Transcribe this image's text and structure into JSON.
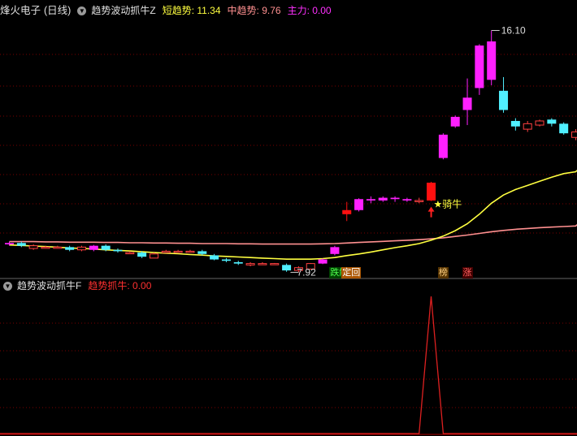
{
  "header": {
    "stock_name": "烽火电子",
    "period": "(日线)",
    "indicator": "趋势波动抓牛Z",
    "short_trend": {
      "label": "短趋势:",
      "value": "11.34",
      "color": "#ffff40"
    },
    "mid_trend": {
      "label": "中趋势:",
      "value": "9.76",
      "color": "#ff9090"
    },
    "main_force": {
      "label": "主力:",
      "value": "0.00",
      "color": "#ff30ff"
    }
  },
  "sub_header": {
    "indicator": "趋势波动抓牛F",
    "signal": {
      "label": "趋势抓牛:",
      "value": "0.00",
      "color": "#ff3030"
    }
  },
  "annotations": {
    "high_price": "16.10",
    "low_price": "7.92",
    "signal_label": "★骑牛"
  },
  "tags": [
    {
      "text": "跌解",
      "color": "#50ff50",
      "bg": "#004400",
      "index": 27
    },
    {
      "text": "定回",
      "color": "#ffffff",
      "bg": "#aa5500",
      "index": 28
    },
    {
      "text": "榜",
      "color": "#ffd080",
      "bg": "#553300",
      "index": 36
    },
    {
      "text": "涨",
      "color": "#ff6060",
      "bg": "#440000",
      "index": 38
    }
  ],
  "colors": {
    "up_hollow": "#ff4040",
    "down": "#50f0ff",
    "magenta": "#ff20ff",
    "red_solid": "#ff1010",
    "grid": "#7a0000",
    "short_line": "#ffff40",
    "mid_line": "#ff9090",
    "sub_line": "#dd2020"
  },
  "chart_data": {
    "type": "candlestick",
    "price_range": [
      7.5,
      16.5
    ],
    "candles": [
      {
        "o": 8.3,
        "c": 8.35,
        "h": 8.4,
        "l": 8.25,
        "k": "m"
      },
      {
        "o": 8.35,
        "c": 8.25,
        "h": 8.4,
        "l": 8.2,
        "k": "d"
      },
      {
        "o": 8.15,
        "c": 8.25,
        "h": 8.3,
        "l": 8.1,
        "k": "u"
      },
      {
        "o": 8.2,
        "c": 8.2,
        "h": 8.25,
        "l": 8.15,
        "k": "u"
      },
      {
        "o": 8.2,
        "c": 8.2,
        "h": 8.25,
        "l": 8.15,
        "k": "u"
      },
      {
        "o": 8.2,
        "c": 8.1,
        "h": 8.25,
        "l": 8.05,
        "k": "d"
      },
      {
        "o": 8.1,
        "c": 8.2,
        "h": 8.25,
        "l": 8.05,
        "k": "u"
      },
      {
        "o": 8.1,
        "c": 8.25,
        "h": 8.28,
        "l": 8.05,
        "k": "m"
      },
      {
        "o": 8.25,
        "c": 8.1,
        "h": 8.3,
        "l": 8.05,
        "k": "d"
      },
      {
        "o": 8.1,
        "c": 8.05,
        "h": 8.15,
        "l": 8.0,
        "k": "d"
      },
      {
        "o": 8.0,
        "c": 8.0,
        "h": 8.05,
        "l": 7.95,
        "k": "u"
      },
      {
        "o": 8.0,
        "c": 7.85,
        "h": 8.05,
        "l": 7.8,
        "k": "d"
      },
      {
        "o": 7.8,
        "c": 7.95,
        "h": 8.0,
        "l": 7.8,
        "k": "u"
      },
      {
        "o": 8.0,
        "c": 8.05,
        "h": 8.1,
        "l": 7.98,
        "k": "u"
      },
      {
        "o": 8.05,
        "c": 8.05,
        "h": 8.1,
        "l": 8.0,
        "k": "u"
      },
      {
        "o": 8.05,
        "c": 8.05,
        "h": 8.1,
        "l": 8.0,
        "k": "u"
      },
      {
        "o": 8.05,
        "c": 7.95,
        "h": 8.1,
        "l": 7.9,
        "k": "d"
      },
      {
        "o": 7.9,
        "c": 7.75,
        "h": 7.95,
        "l": 7.72,
        "k": "d"
      },
      {
        "o": 7.75,
        "c": 7.7,
        "h": 7.8,
        "l": 7.65,
        "k": "d"
      },
      {
        "o": 7.65,
        "c": 7.6,
        "h": 7.7,
        "l": 7.55,
        "k": "d"
      },
      {
        "o": 7.55,
        "c": 7.6,
        "h": 7.65,
        "l": 7.5,
        "k": "u"
      },
      {
        "o": 7.6,
        "c": 7.6,
        "h": 7.65,
        "l": 7.55,
        "k": "u"
      },
      {
        "o": 7.6,
        "c": 7.58,
        "h": 7.62,
        "l": 7.55,
        "k": "u"
      },
      {
        "o": 7.55,
        "c": 7.35,
        "h": 7.6,
        "l": 7.3,
        "k": "d"
      },
      {
        "o": 7.35,
        "c": 7.45,
        "h": 7.5,
        "l": 7.28,
        "k": "u"
      },
      {
        "o": 7.4,
        "c": 7.6,
        "h": 7.62,
        "l": 7.38,
        "k": "u"
      },
      {
        "o": 7.6,
        "c": 7.75,
        "h": 7.78,
        "l": 7.58,
        "k": "m"
      },
      {
        "o": 7.95,
        "c": 8.2,
        "h": 8.25,
        "l": 7.9,
        "k": "m"
      },
      {
        "o": 9.4,
        "c": 9.55,
        "h": 9.85,
        "l": 9.15,
        "k": "r"
      },
      {
        "o": 9.55,
        "c": 9.95,
        "h": 9.98,
        "l": 9.5,
        "k": "m"
      },
      {
        "o": 9.9,
        "c": 9.95,
        "h": 10.05,
        "l": 9.8,
        "k": "m"
      },
      {
        "o": 9.9,
        "c": 10.0,
        "h": 10.05,
        "l": 9.85,
        "k": "m"
      },
      {
        "o": 9.95,
        "c": 10.0,
        "h": 10.05,
        "l": 9.85,
        "k": "m"
      },
      {
        "o": 9.95,
        "c": 9.9,
        "h": 10.0,
        "l": 9.85,
        "k": "m"
      },
      {
        "o": 9.9,
        "c": 9.9,
        "h": 10.0,
        "l": 9.8,
        "k": "u"
      },
      {
        "o": 9.9,
        "c": 10.55,
        "h": 10.58,
        "l": 9.88,
        "k": "r"
      },
      {
        "o": 11.45,
        "c": 12.3,
        "h": 12.35,
        "l": 11.4,
        "k": "m"
      },
      {
        "o": 12.6,
        "c": 12.95,
        "h": 13.0,
        "l": 12.55,
        "k": "m"
      },
      {
        "o": 13.2,
        "c": 13.65,
        "h": 14.35,
        "l": 12.65,
        "k": "m"
      },
      {
        "o": 14.0,
        "c": 15.55,
        "h": 15.6,
        "l": 13.75,
        "k": "m"
      },
      {
        "o": 14.3,
        "c": 15.7,
        "h": 16.1,
        "l": 14.1,
        "k": "m"
      },
      {
        "o": 13.9,
        "c": 13.2,
        "h": 14.4,
        "l": 13.1,
        "k": "d"
      },
      {
        "o": 12.8,
        "c": 12.6,
        "h": 12.9,
        "l": 12.45,
        "k": "d"
      },
      {
        "o": 12.5,
        "c": 12.7,
        "h": 12.8,
        "l": 12.4,
        "k": "u"
      },
      {
        "o": 12.65,
        "c": 12.8,
        "h": 12.85,
        "l": 12.6,
        "k": "u"
      },
      {
        "o": 12.85,
        "c": 12.7,
        "h": 12.9,
        "l": 12.6,
        "k": "d"
      },
      {
        "o": 12.7,
        "c": 12.35,
        "h": 12.75,
        "l": 12.3,
        "k": "d"
      },
      {
        "o": 12.2,
        "c": 12.4,
        "h": 12.5,
        "l": 12.1,
        "k": "u"
      }
    ],
    "short_trend_line": [
      8.28,
      8.26,
      8.24,
      8.22,
      8.2,
      8.17,
      8.15,
      8.13,
      8.1,
      8.08,
      8.06,
      8.03,
      8.0,
      7.98,
      7.96,
      7.93,
      7.91,
      7.88,
      7.86,
      7.84,
      7.82,
      7.8,
      7.78,
      7.76,
      7.76,
      7.76,
      7.78,
      7.82,
      7.89,
      7.95,
      8.02,
      8.1,
      8.18,
      8.25,
      8.33,
      8.45,
      8.6,
      8.8,
      9.05,
      9.4,
      9.8,
      10.1,
      10.3,
      10.45,
      10.6,
      10.75,
      10.88,
      10.95
    ],
    "mid_trend_line": [
      8.4,
      8.4,
      8.4,
      8.39,
      8.39,
      8.38,
      8.38,
      8.38,
      8.37,
      8.37,
      8.36,
      8.36,
      8.35,
      8.35,
      8.34,
      8.34,
      8.33,
      8.33,
      8.33,
      8.32,
      8.32,
      8.31,
      8.31,
      8.31,
      8.31,
      8.31,
      8.32,
      8.33,
      8.35,
      8.37,
      8.39,
      8.41,
      8.43,
      8.45,
      8.47,
      8.5,
      8.54,
      8.59,
      8.64,
      8.7,
      8.76,
      8.81,
      8.85,
      8.88,
      8.91,
      8.93,
      8.95,
      8.97
    ],
    "sub_indicator": {
      "name": "趋势抓牛",
      "range": [
        0,
        100
      ],
      "values": [
        0,
        0,
        0,
        0,
        0,
        0,
        0,
        0,
        0,
        0,
        0,
        0,
        0,
        0,
        0,
        0,
        0,
        0,
        0,
        0,
        0,
        0,
        0,
        0,
        0,
        0,
        0,
        0,
        0,
        0,
        0,
        0,
        0,
        0,
        0,
        100,
        0,
        0,
        0,
        0,
        0,
        0,
        0,
        0,
        0,
        0,
        0,
        0
      ]
    }
  }
}
